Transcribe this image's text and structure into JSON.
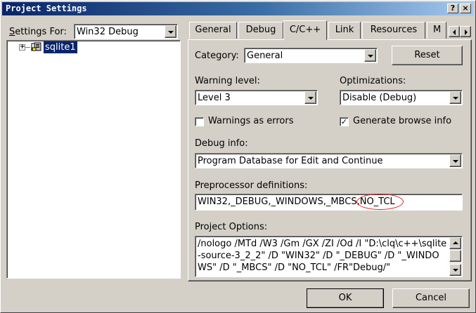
{
  "window": {
    "title": "Project Settings",
    "help_button": "?",
    "close_button": "×"
  },
  "left": {
    "settings_for_label": "Settings For:",
    "settings_for_value": "Win32 Debug",
    "tree": {
      "expand": "+",
      "project_name": "sqlite1"
    }
  },
  "tabs": [
    {
      "label": "General"
    },
    {
      "label": "Debug"
    },
    {
      "label": "C/C++",
      "active": true
    },
    {
      "label": "Link"
    },
    {
      "label": "Resources"
    },
    {
      "label": "M"
    }
  ],
  "cpp": {
    "category_label": "Category:",
    "category_value": "General",
    "reset_label": "Reset",
    "warning_level_label": "Warning level:",
    "warning_level_value": "Level 3",
    "optimizations_label": "Optimizations:",
    "optimizations_value": "Disable (Debug)",
    "warnings_as_errors_label": "Warnings as errors",
    "warnings_as_errors_checked": false,
    "browse_info_label": "Generate browse info",
    "browse_info_checked": true,
    "checkmark": "✓",
    "debug_info_label": "Debug info:",
    "debug_info_value": "Program Database for Edit and Continue",
    "preprocessor_label": "Preprocessor definitions:",
    "preprocessor_prefix": "WIN32,_DEBUG,_WINDOWS,_MBCS,",
    "preprocessor_highlight": "NO_TCL",
    "project_options_label": "Project Options:",
    "project_options_value": "/nologo /MTd /W3 /Gm /GX /ZI /Od /I \"D:\\clq\\c++\\sqlite-source-3_2_2\" /D \"WIN32\" /D \"_DEBUG\" /D \"_WINDOWS\" /D \"_MBCS\" /D \"NO_TCL\" /FR\"Debug/\""
  },
  "footer": {
    "ok_label": "OK",
    "cancel_label": "Cancel"
  },
  "colors": {
    "title_start": "#0a246a",
    "title_end": "#a6caf0",
    "face": "#d4d0c8",
    "selection": "#0a246a",
    "annotation_circle": "#e02020"
  }
}
